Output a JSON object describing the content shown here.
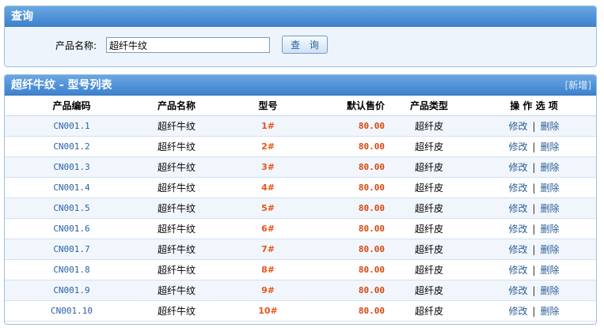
{
  "search": {
    "title": "查询",
    "label": "产品名称:",
    "value": "超纤牛纹",
    "button_label": "查 询"
  },
  "list": {
    "title": "超纤牛纹 - 型号列表",
    "add_bracket_open": "[",
    "add_label": "新增",
    "add_bracket_close": "]",
    "columns": {
      "code": "产品编码",
      "name": "产品名称",
      "model": "型号",
      "price": "默认售价",
      "type": "产品类型",
      "ops": "操 作 选 项"
    },
    "edit_label": "修改",
    "separator": "|",
    "delete_label": "删除",
    "rows": [
      {
        "code": "CN001.1",
        "name": "超纤牛纹",
        "model": "1#",
        "price": "80.00",
        "type": "超纤皮"
      },
      {
        "code": "CN001.2",
        "name": "超纤牛纹",
        "model": "2#",
        "price": "80.00",
        "type": "超纤皮"
      },
      {
        "code": "CN001.3",
        "name": "超纤牛纹",
        "model": "3#",
        "price": "80.00",
        "type": "超纤皮"
      },
      {
        "code": "CN001.4",
        "name": "超纤牛纹",
        "model": "4#",
        "price": "80.00",
        "type": "超纤皮"
      },
      {
        "code": "CN001.5",
        "name": "超纤牛纹",
        "model": "5#",
        "price": "80.00",
        "type": "超纤皮"
      },
      {
        "code": "CN001.6",
        "name": "超纤牛纹",
        "model": "6#",
        "price": "80.00",
        "type": "超纤皮"
      },
      {
        "code": "CN001.7",
        "name": "超纤牛纹",
        "model": "7#",
        "price": "80.00",
        "type": "超纤皮"
      },
      {
        "code": "CN001.8",
        "name": "超纤牛纹",
        "model": "8#",
        "price": "80.00",
        "type": "超纤皮"
      },
      {
        "code": "CN001.9",
        "name": "超纤牛纹",
        "model": "9#",
        "price": "80.00",
        "type": "超纤皮"
      },
      {
        "code": "CN001.10",
        "name": "超纤牛纹",
        "model": "10#",
        "price": "80.00",
        "type": "超纤皮"
      }
    ]
  }
}
